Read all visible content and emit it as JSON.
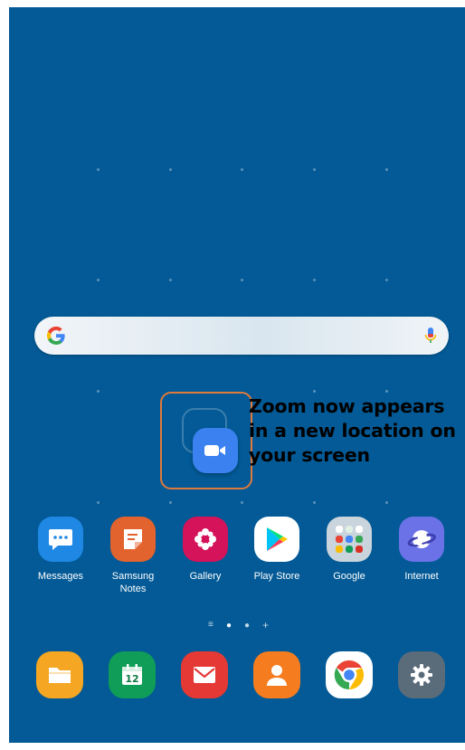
{
  "search": {
    "google_letter": "G"
  },
  "annotation": {
    "line1": "Zoom now appears",
    "line2": "in a new location on",
    "line3": "your screen",
    "highlight_color": "#e07a3b"
  },
  "home_apps": [
    {
      "label": "Messages",
      "icon": "messages-icon",
      "color": "#1f88e5"
    },
    {
      "label": "Samsung\nNotes",
      "icon": "samsung-notes-icon",
      "color": "#e2632e"
    },
    {
      "label": "Gallery",
      "icon": "gallery-icon",
      "color": "#d4135a"
    },
    {
      "label": "Play Store",
      "icon": "play-store-icon",
      "color": "#ffffff"
    },
    {
      "label": "Google",
      "icon": "google-folder-icon",
      "color": "#c9d4dc"
    },
    {
      "label": "Internet",
      "icon": "internet-icon",
      "color": "#6b72e8"
    }
  ],
  "pager": {
    "list": "≡",
    "current": "●",
    "page": "●",
    "add": "+"
  },
  "dock": [
    {
      "icon": "my-files-icon",
      "color": "#f5a623"
    },
    {
      "icon": "calendar-icon",
      "color": "#0f9d58",
      "text": "12"
    },
    {
      "icon": "email-icon",
      "color": "#e53935"
    },
    {
      "icon": "contacts-icon",
      "color": "#f57c1f"
    },
    {
      "icon": "chrome-icon",
      "color": "#ffffff"
    },
    {
      "icon": "settings-icon",
      "color": "#5a6b7a"
    }
  ]
}
